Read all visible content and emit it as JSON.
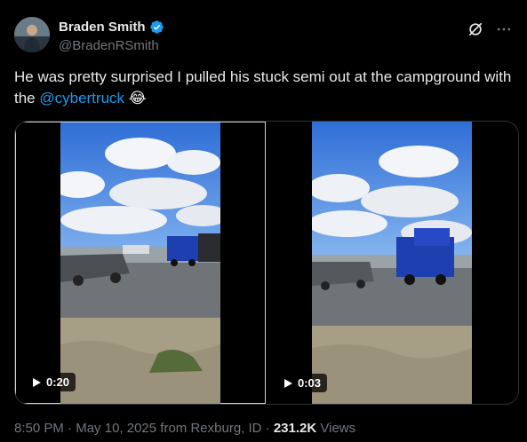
{
  "author": {
    "display_name": "Braden Smith",
    "handle": "@BradenRSmith"
  },
  "tweet": {
    "text_before": "He was pretty surprised I pulled his stuck semi out at the campground with the ",
    "mention": "@cybertruck",
    "emoji": "😂"
  },
  "media": {
    "videos": [
      {
        "duration": "0:20"
      },
      {
        "duration": "0:03"
      }
    ]
  },
  "meta": {
    "time": "8:50 PM",
    "date": "May 10, 2025",
    "location": "from Rexburg, ID",
    "separator": "·",
    "views_count": "231.2K",
    "views_label": "Views"
  },
  "colors": {
    "background": "#000000",
    "text": "#e7e9ea",
    "secondary": "#71767b",
    "link": "#1d9bf0",
    "verified": "#1d9bf0"
  },
  "icons": [
    "verified-badge-icon",
    "grok-icon",
    "more-icon",
    "play-icon"
  ]
}
